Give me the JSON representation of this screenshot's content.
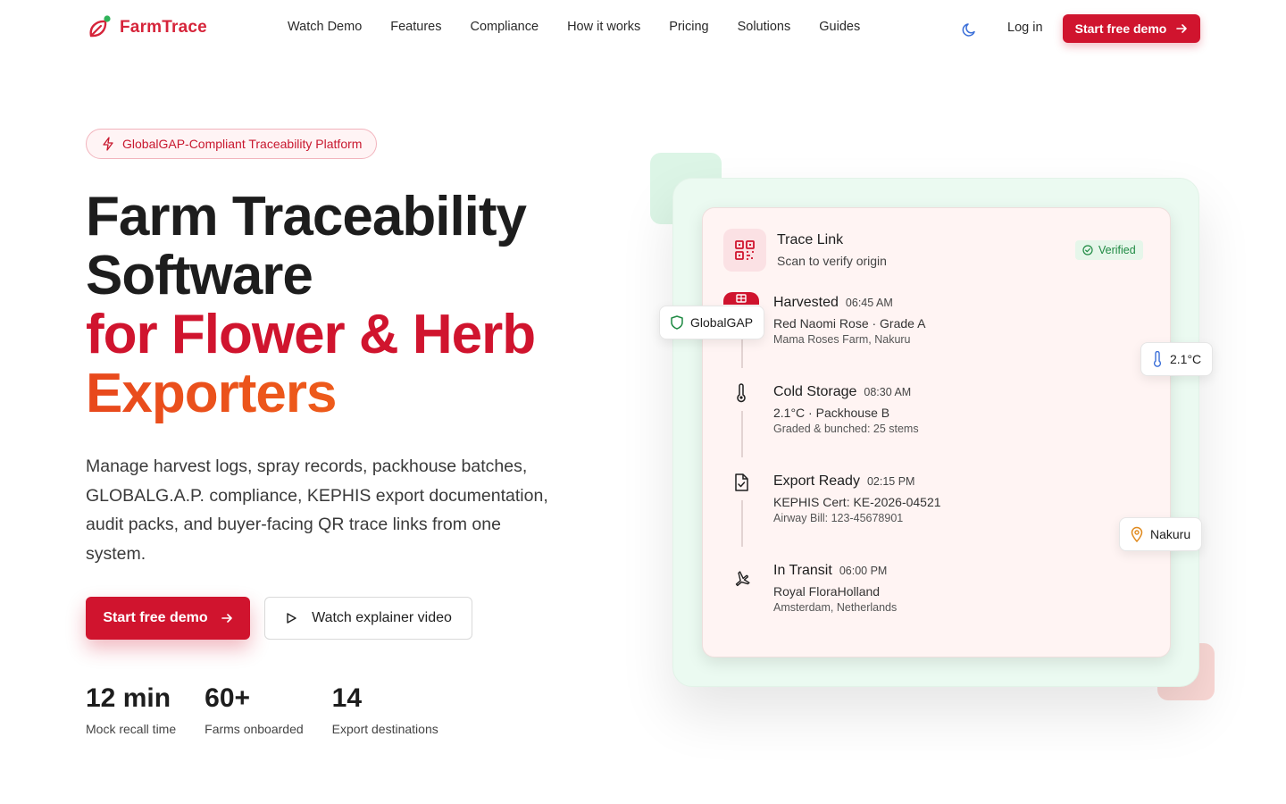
{
  "brand": {
    "name": "FarmTrace",
    "color": "#d6243a"
  },
  "nav": {
    "links": [
      "Watch Demo",
      "Features",
      "Compliance",
      "How it works",
      "Pricing",
      "Solutions",
      "Guides"
    ],
    "login": "Log in",
    "cta": "Start free demo",
    "theme_icon": "moon-icon"
  },
  "hero": {
    "badge": "GlobalGAP-Compliant Traceability Platform",
    "title_line1": "Farm Traceability",
    "title_line2": "Software",
    "title_line3": "for Flower & Herb",
    "title_line4": "Exporters",
    "lead": "Manage harvest logs, spray records, packhouse batches, GLOBALG.A.P. compliance, KEPHIS export documentation, audit packs, and buyer-facing QR trace links from one system.",
    "primary_cta": "Start free demo",
    "secondary_cta": "Watch explainer video",
    "stats": [
      {
        "value": "12 min",
        "label": "Mock recall time"
      },
      {
        "value": "60+",
        "label": "Farms onboarded"
      },
      {
        "value": "14",
        "label": "Export destinations"
      }
    ]
  },
  "trace_card": {
    "title": "Trace Link",
    "subtitle": "Scan to verify origin",
    "status": "Verified",
    "steps": [
      {
        "title": "Harvested",
        "time": "06:45 AM",
        "line1": "Red Naomi Rose · Grade A",
        "line2": "Mama Roses Farm, Nakuru",
        "icon": "harvest-icon"
      },
      {
        "title": "Cold Storage",
        "time": "08:30 AM",
        "line1": "2.1°C · Packhouse B",
        "line2": "Graded & bunched: 25 stems",
        "icon": "thermometer-icon"
      },
      {
        "title": "Export Ready",
        "time": "02:15 PM",
        "line1": "KEPHIS Cert: KE-2026-04521",
        "line2": "Airway Bill: 123-45678901",
        "icon": "document-check-icon"
      },
      {
        "title": "In Transit",
        "time": "06:00 PM",
        "line1": "Royal FloraHolland",
        "line2": "Amsterdam, Netherlands",
        "icon": "plane-icon"
      }
    ]
  },
  "chips": {
    "globalgap": "GlobalGAP",
    "temperature": "2.1°C",
    "location": "Nakuru"
  },
  "colors": {
    "accent": "#d0142e",
    "orange": "#ee5a1a",
    "verified": "#1f8a43",
    "green_bg": "#ebfaf1"
  }
}
